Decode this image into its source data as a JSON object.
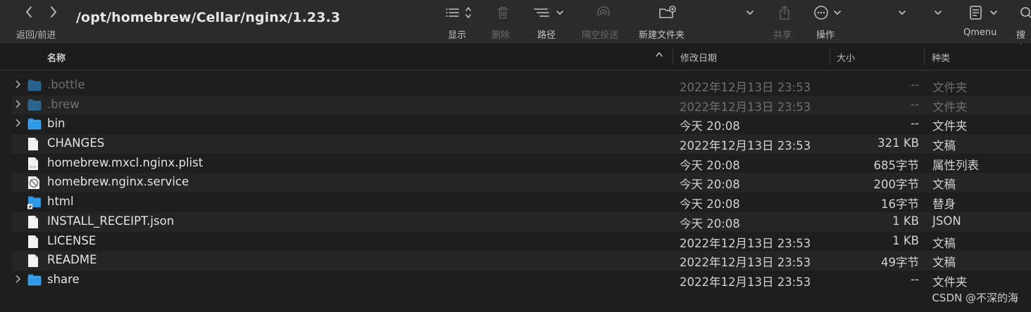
{
  "toolbar": {
    "back_forward_label": "返回/前进",
    "path_title": "/opt/homebrew/Cellar/nginx/1.23.3",
    "view_label": "显示",
    "delete_label": "删除",
    "path_label": "路径",
    "airdrop_label": "隔空投送",
    "new_folder_label": "新建文件夹",
    "share_label": "共享",
    "action_label": "操作",
    "qmenu_label": "Qmenu",
    "search_label": "搜索"
  },
  "columns": {
    "name": "名称",
    "modified": "修改日期",
    "size": "大小",
    "kind": "种类"
  },
  "files": [
    {
      "name": ".bottle",
      "date": "2022年12月13日 23:53",
      "size": "--",
      "kind": "文件夹",
      "icon": "folder-icon",
      "hidden": true,
      "expandable": true
    },
    {
      "name": ".brew",
      "date": "2022年12月13日 23:53",
      "size": "--",
      "kind": "文件夹",
      "icon": "folder-icon",
      "hidden": true,
      "expandable": true
    },
    {
      "name": "bin",
      "date": "今天 20:08",
      "size": "--",
      "kind": "文件夹",
      "icon": "folder-icon",
      "hidden": false,
      "expandable": true
    },
    {
      "name": "CHANGES",
      "date": "2022年12月13日 23:53",
      "size": "321 KB",
      "kind": "文稿",
      "icon": "document-icon",
      "hidden": false,
      "expandable": false
    },
    {
      "name": "homebrew.mxcl.nginx.plist",
      "date": "今天 20:08",
      "size": "685字节",
      "kind": "属性列表",
      "icon": "plist-icon",
      "hidden": false,
      "expandable": false
    },
    {
      "name": "homebrew.nginx.service",
      "date": "今天 20:08",
      "size": "200字节",
      "kind": "文稿",
      "icon": "blocked-file-icon",
      "hidden": false,
      "expandable": false
    },
    {
      "name": "html",
      "date": "今天 20:08",
      "size": "16字节",
      "kind": "替身",
      "icon": "alias-folder-icon",
      "hidden": false,
      "expandable": false
    },
    {
      "name": "INSTALL_RECEIPT.json",
      "date": "今天 20:08",
      "size": "1 KB",
      "kind": "JSON",
      "icon": "document-icon",
      "hidden": false,
      "expandable": false
    },
    {
      "name": "LICENSE",
      "date": "2022年12月13日 23:53",
      "size": "1 KB",
      "kind": "文稿",
      "icon": "document-icon",
      "hidden": false,
      "expandable": false
    },
    {
      "name": "README",
      "date": "2022年12月13日 23:53",
      "size": "49字节",
      "kind": "文稿",
      "icon": "document-icon",
      "hidden": false,
      "expandable": false
    },
    {
      "name": "share",
      "date": "2022年12月13日 23:53",
      "size": "--",
      "kind": "文件夹",
      "icon": "folder-icon",
      "hidden": false,
      "expandable": true
    }
  ],
  "watermark": "CSDN @不深的海",
  "colors": {
    "folder": "#2f9ae8",
    "background": "#1e1e1e",
    "toolbar": "#2b2b2b"
  }
}
